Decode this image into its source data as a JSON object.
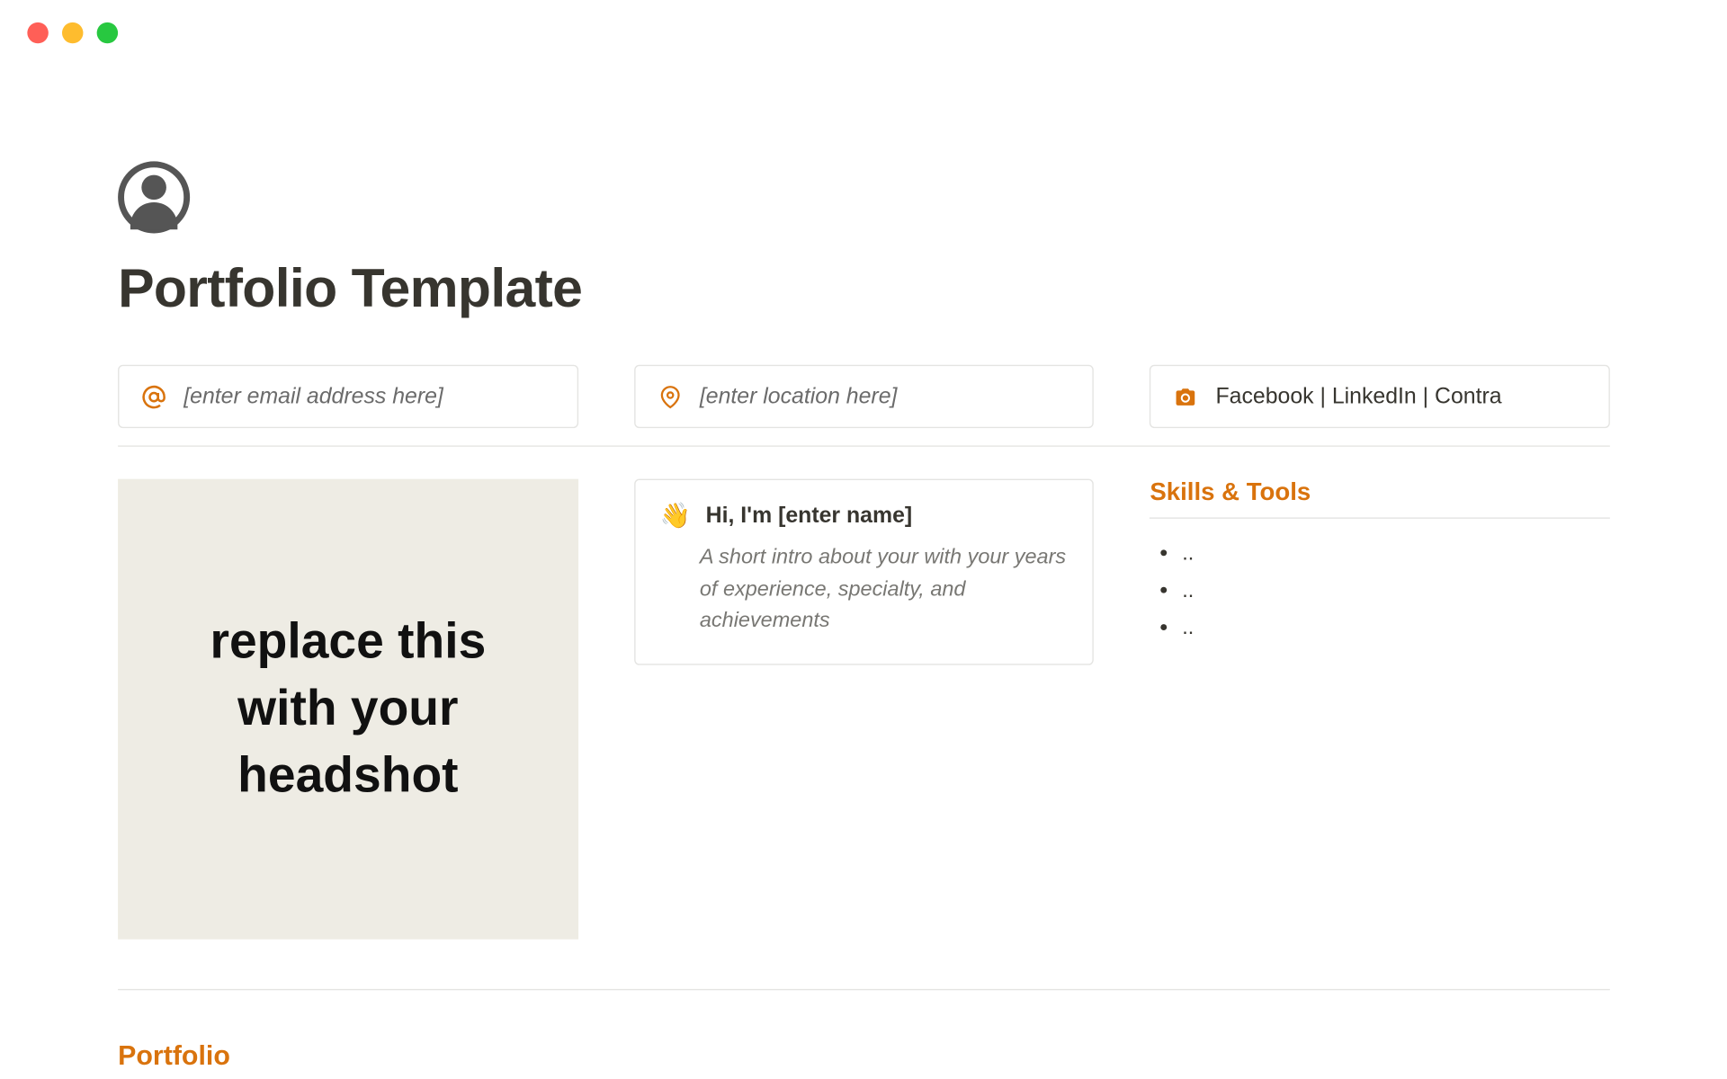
{
  "title": "Portfolio Template",
  "info": {
    "email_placeholder": "[enter email address here]",
    "location_placeholder": "[enter location here]",
    "socials": "Facebook | LinkedIn | Contra"
  },
  "headshot": {
    "placeholder_text": "replace this with your headshot"
  },
  "intro": {
    "emoji": "👋",
    "title": "Hi, I'm [enter name]",
    "description": "A short intro about your with your years of experience, specialty, and achievements"
  },
  "skills": {
    "heading": "Skills & Tools",
    "items": [
      "..",
      "..",
      ".."
    ]
  },
  "sections": {
    "portfolio_heading": "Portfolio"
  },
  "colors": {
    "accent": "#d9730d",
    "text": "#37352f",
    "muted": "#787773",
    "border": "#e4e4e2",
    "headshot_bg": "#eeece4"
  }
}
